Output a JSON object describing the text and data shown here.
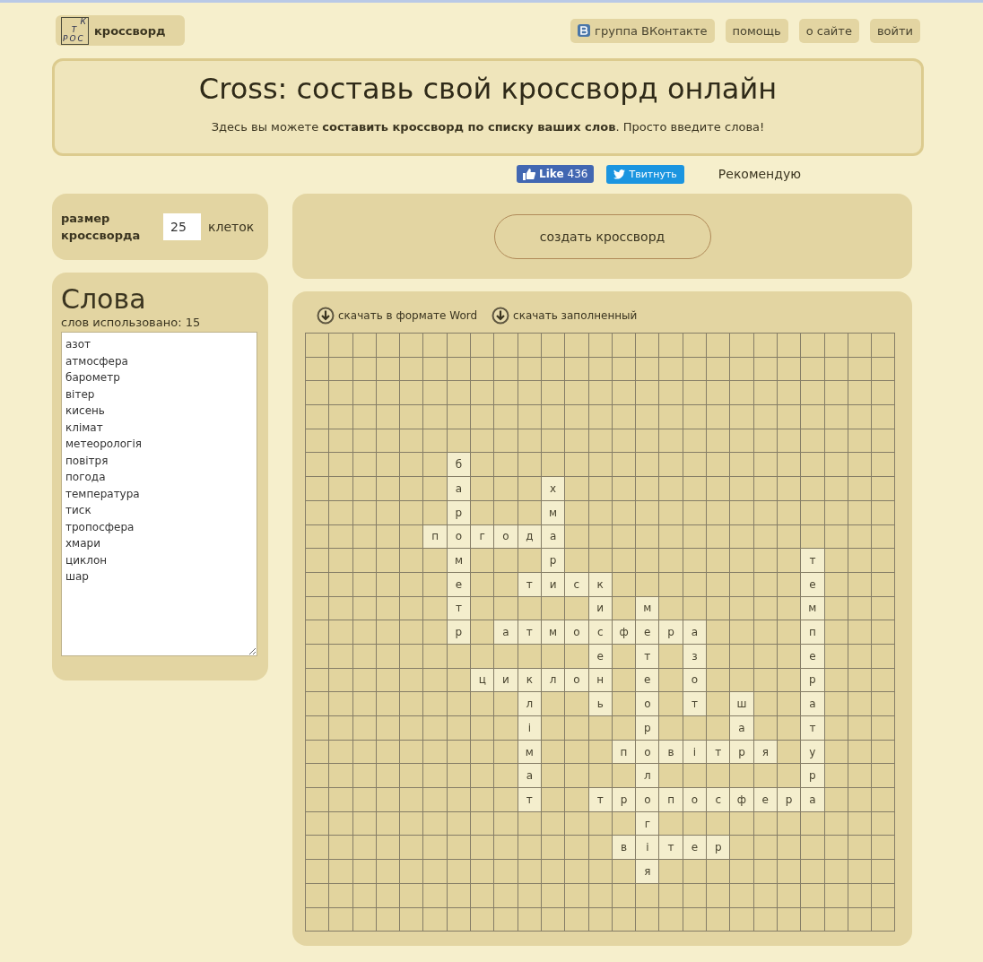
{
  "logo": {
    "letters": [
      "К",
      "Т",
      "РОС"
    ],
    "label": "кроссворд"
  },
  "nav": [
    {
      "label": "группа ВКонтакте",
      "kind": "vk"
    },
    {
      "label": "помощь",
      "kind": "plain"
    },
    {
      "label": "о сайте",
      "kind": "plain"
    },
    {
      "label": "войти",
      "kind": "plain"
    }
  ],
  "header": {
    "title": "Cross: составь свой кроссворд онлайн",
    "subtitle": "Здесь вы можете **составить кроссворд по списку ваших слов**. Просто введите слова!"
  },
  "social": {
    "like": {
      "label": "Like",
      "count": "436"
    },
    "tweet": "Твитнуть",
    "recommend": "Рекомендую"
  },
  "size": {
    "label": "размер кроссворда",
    "value": "25",
    "unit": "клеток"
  },
  "create_button": "создать кроссворд",
  "words_panel": {
    "title": "Слова",
    "used": "слов использовано: 15",
    "words": [
      "азот",
      "атмосфера",
      "барометр",
      "вітер",
      "кисень",
      "клімат",
      "метеорологія",
      "повітря",
      "погода",
      "температура",
      "тиск",
      "тропосфера",
      "хмари",
      "циклон",
      "шар"
    ]
  },
  "downloads": [
    "скачать в формате Word",
    "скачать заполненный"
  ],
  "grid": {
    "rows": [
      [
        null,
        null,
        null,
        null,
        null,
        null,
        null,
        null,
        null,
        null,
        null,
        null,
        null,
        null,
        null,
        null,
        null,
        null,
        null,
        null,
        null,
        null,
        null,
        null,
        null
      ],
      [
        null,
        null,
        null,
        null,
        null,
        null,
        null,
        null,
        null,
        null,
        null,
        null,
        null,
        null,
        null,
        null,
        null,
        null,
        null,
        null,
        null,
        null,
        null,
        null,
        null
      ],
      [
        null,
        null,
        null,
        null,
        null,
        null,
        null,
        null,
        null,
        null,
        null,
        null,
        null,
        null,
        null,
        null,
        null,
        null,
        null,
        null,
        null,
        null,
        null,
        null,
        null
      ],
      [
        null,
        null,
        null,
        null,
        null,
        null,
        null,
        null,
        null,
        null,
        null,
        null,
        null,
        null,
        null,
        null,
        null,
        null,
        null,
        null,
        null,
        null,
        null,
        null,
        null
      ],
      [
        null,
        null,
        null,
        null,
        null,
        null,
        null,
        null,
        null,
        null,
        null,
        null,
        null,
        null,
        null,
        null,
        null,
        null,
        null,
        null,
        null,
        null,
        null,
        null,
        null
      ],
      [
        null,
        null,
        null,
        null,
        null,
        null,
        "б",
        null,
        null,
        null,
        null,
        null,
        null,
        null,
        null,
        null,
        null,
        null,
        null,
        null,
        null,
        null,
        null,
        null,
        null
      ],
      [
        null,
        null,
        null,
        null,
        null,
        null,
        "а",
        null,
        null,
        null,
        "х",
        null,
        null,
        null,
        null,
        null,
        null,
        null,
        null,
        null,
        null,
        null,
        null,
        null,
        null
      ],
      [
        null,
        null,
        null,
        null,
        null,
        null,
        "р",
        null,
        null,
        null,
        "м",
        null,
        null,
        null,
        null,
        null,
        null,
        null,
        null,
        null,
        null,
        null,
        null,
        null,
        null
      ],
      [
        null,
        null,
        null,
        null,
        null,
        "п",
        "о",
        "г",
        "о",
        "д",
        "а",
        null,
        null,
        null,
        null,
        null,
        null,
        null,
        null,
        null,
        null,
        null,
        null,
        null,
        null
      ],
      [
        null,
        null,
        null,
        null,
        null,
        null,
        "м",
        null,
        null,
        null,
        "р",
        null,
        null,
        null,
        null,
        null,
        null,
        null,
        null,
        null,
        null,
        "т",
        null,
        null,
        null
      ],
      [
        null,
        null,
        null,
        null,
        null,
        null,
        "е",
        null,
        null,
        "т",
        "и",
        "с",
        "к",
        null,
        null,
        null,
        null,
        null,
        null,
        null,
        null,
        "е",
        null,
        null,
        null
      ],
      [
        null,
        null,
        null,
        null,
        null,
        null,
        "т",
        null,
        null,
        null,
        null,
        null,
        "и",
        null,
        "м",
        null,
        null,
        null,
        null,
        null,
        null,
        "м",
        null,
        null,
        null
      ],
      [
        null,
        null,
        null,
        null,
        null,
        null,
        "р",
        null,
        "а",
        "т",
        "м",
        "о",
        "с",
        "ф",
        "е",
        "р",
        "а",
        null,
        null,
        null,
        null,
        "п",
        null,
        null,
        null
      ],
      [
        null,
        null,
        null,
        null,
        null,
        null,
        null,
        null,
        null,
        null,
        null,
        null,
        "е",
        null,
        "т",
        null,
        "з",
        null,
        null,
        null,
        null,
        "е",
        null,
        null,
        null
      ],
      [
        null,
        null,
        null,
        null,
        null,
        null,
        null,
        "ц",
        "и",
        "к",
        "л",
        "о",
        "н",
        null,
        "е",
        null,
        "о",
        null,
        null,
        null,
        null,
        "р",
        null,
        null,
        null
      ],
      [
        null,
        null,
        null,
        null,
        null,
        null,
        null,
        null,
        null,
        "л",
        null,
        null,
        "ь",
        null,
        "о",
        null,
        "т",
        null,
        "ш",
        null,
        null,
        "а",
        null,
        null,
        null
      ],
      [
        null,
        null,
        null,
        null,
        null,
        null,
        null,
        null,
        null,
        "і",
        null,
        null,
        null,
        null,
        "р",
        null,
        null,
        null,
        "а",
        null,
        null,
        "т",
        null,
        null,
        null
      ],
      [
        null,
        null,
        null,
        null,
        null,
        null,
        null,
        null,
        null,
        "м",
        null,
        null,
        null,
        "п",
        "о",
        "в",
        "і",
        "т",
        "р",
        "я",
        null,
        "у",
        null,
        null,
        null
      ],
      [
        null,
        null,
        null,
        null,
        null,
        null,
        null,
        null,
        null,
        "а",
        null,
        null,
        null,
        null,
        "л",
        null,
        null,
        null,
        null,
        null,
        null,
        "р",
        null,
        null,
        null
      ],
      [
        null,
        null,
        null,
        null,
        null,
        null,
        null,
        null,
        null,
        "т",
        null,
        null,
        "т",
        "р",
        "о",
        "п",
        "о",
        "с",
        "ф",
        "е",
        "р",
        "а",
        null,
        null,
        null
      ],
      [
        null,
        null,
        null,
        null,
        null,
        null,
        null,
        null,
        null,
        null,
        null,
        null,
        null,
        null,
        "г",
        null,
        null,
        null,
        null,
        null,
        null,
        null,
        null,
        null,
        null
      ],
      [
        null,
        null,
        null,
        null,
        null,
        null,
        null,
        null,
        null,
        null,
        null,
        null,
        null,
        "в",
        "і",
        "т",
        "е",
        "р",
        null,
        null,
        null,
        null,
        null,
        null,
        null
      ],
      [
        null,
        null,
        null,
        null,
        null,
        null,
        null,
        null,
        null,
        null,
        null,
        null,
        null,
        null,
        "я",
        null,
        null,
        null,
        null,
        null,
        null,
        null,
        null,
        null,
        null
      ],
      [
        null,
        null,
        null,
        null,
        null,
        null,
        null,
        null,
        null,
        null,
        null,
        null,
        null,
        null,
        null,
        null,
        null,
        null,
        null,
        null,
        null,
        null,
        null,
        null,
        null
      ],
      [
        null,
        null,
        null,
        null,
        null,
        null,
        null,
        null,
        null,
        null,
        null,
        null,
        null,
        null,
        null,
        null,
        null,
        null,
        null,
        null,
        null,
        null,
        null,
        null,
        null
      ]
    ]
  }
}
